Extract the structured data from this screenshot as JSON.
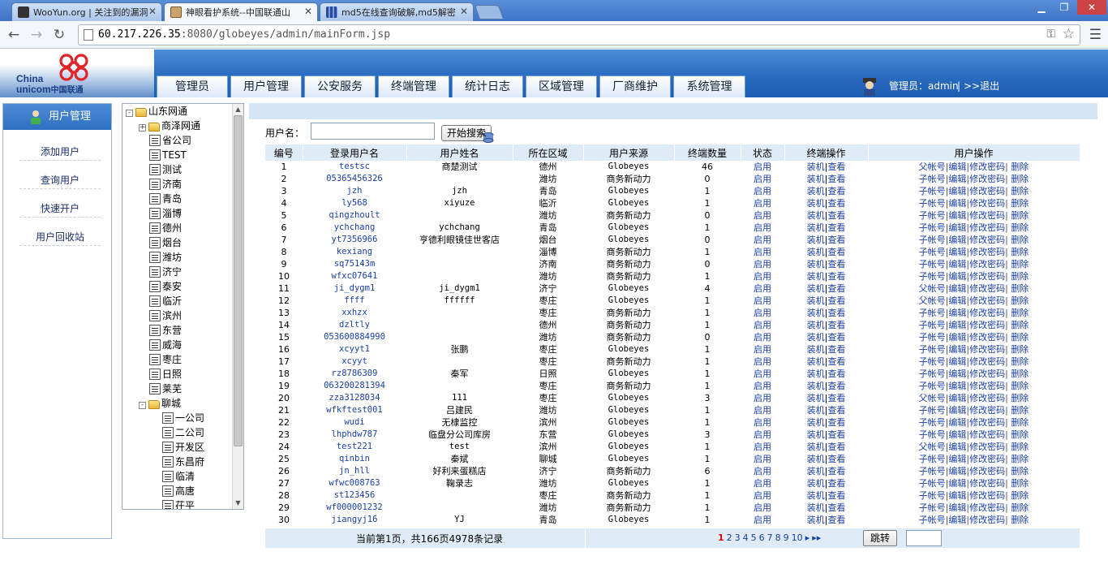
{
  "browser": {
    "tabs": [
      {
        "title": "WooYun.org | 关注到的漏洞"
      },
      {
        "title": "神眼看护系统--中国联通山"
      },
      {
        "title": "md5在线查询破解,md5解密"
      }
    ],
    "url_host": "60.217.226.35",
    "url_rest": ":8080/globeyes/admin/mainForm.jsp"
  },
  "header": {
    "logo_en_1": "China",
    "logo_en_2": "unicom",
    "logo_cn": "中国联通",
    "nav": [
      "管理员",
      "用户管理",
      "公安服务",
      "终端管理",
      "统计日志",
      "区域管理",
      "厂商维护",
      "系统管理"
    ],
    "admin_label": "管理员：",
    "admin_name": "admin",
    "sep": "|",
    "logout": ">>退出"
  },
  "sidebar": {
    "title": "用户管理",
    "items": [
      "添加用户",
      "查询用户",
      "快速开户",
      "用户回收站"
    ]
  },
  "tree": {
    "root": "山东网通",
    "nodes": [
      {
        "label": "商泽网通",
        "type": "folder",
        "expander": "+"
      },
      {
        "label": "省公司",
        "type": "doc"
      },
      {
        "label": "TEST",
        "type": "doc"
      },
      {
        "label": "测试",
        "type": "doc"
      },
      {
        "label": "济南",
        "type": "doc"
      },
      {
        "label": "青岛",
        "type": "doc"
      },
      {
        "label": "淄博",
        "type": "doc"
      },
      {
        "label": "德州",
        "type": "doc"
      },
      {
        "label": "烟台",
        "type": "doc"
      },
      {
        "label": "潍坊",
        "type": "doc"
      },
      {
        "label": "济宁",
        "type": "doc"
      },
      {
        "label": "泰安",
        "type": "doc"
      },
      {
        "label": "临沂",
        "type": "doc"
      },
      {
        "label": "滨州",
        "type": "doc"
      },
      {
        "label": "东营",
        "type": "doc"
      },
      {
        "label": "威海",
        "type": "doc"
      },
      {
        "label": "枣庄",
        "type": "doc"
      },
      {
        "label": "日照",
        "type": "doc"
      },
      {
        "label": "莱芜",
        "type": "doc"
      },
      {
        "label": "聊城",
        "type": "folder",
        "expander": "-"
      }
    ],
    "children": [
      "一公司",
      "二公司",
      "开发区",
      "东昌府",
      "临清",
      "高唐",
      "茌平"
    ]
  },
  "search": {
    "label": "用户名：",
    "value": "",
    "button": "开始搜索"
  },
  "grid": {
    "headers": [
      "编号",
      "登录用户名",
      "用户姓名",
      "所在区域",
      "用户来源",
      "终端数量",
      "状态",
      "终端操作",
      "用户操作"
    ],
    "status_link": "启用",
    "term_ops": [
      "装机",
      "查看"
    ],
    "user_ops_child": "子帐号",
    "user_ops_parent": "父帐号",
    "user_ops": [
      "编辑",
      "修改密码",
      "删除"
    ],
    "rows": [
      [
        "1",
        "testsc",
        "商楚测试",
        "德州",
        "Globeyes",
        "46",
        "P"
      ],
      [
        "2",
        "05365456326",
        "",
        "潍坊",
        "商务新动力",
        "0",
        "C"
      ],
      [
        "3",
        "jzh",
        "jzh",
        "青岛",
        "Globeyes",
        "1",
        "C"
      ],
      [
        "4",
        "ly568",
        "xiyuze",
        "临沂",
        "Globeyes",
        "1",
        "C"
      ],
      [
        "5",
        "qingzhoult",
        "",
        "潍坊",
        "商务新动力",
        "0",
        "C"
      ],
      [
        "6",
        "ychchang",
        "ychchang",
        "青岛",
        "Globeyes",
        "1",
        "C"
      ],
      [
        "7",
        "yt7356966",
        "亨德利眼镜佳世客店",
        "烟台",
        "Globeyes",
        "0",
        "C"
      ],
      [
        "8",
        "kexiang",
        "",
        "淄博",
        "商务新动力",
        "1",
        "C"
      ],
      [
        "9",
        "sq75143m",
        "",
        "济南",
        "商务新动力",
        "0",
        "C"
      ],
      [
        "10",
        "wfxc07641",
        "",
        "潍坊",
        "商务新动力",
        "1",
        "C"
      ],
      [
        "11",
        "ji_dygm1",
        "ji_dygm1",
        "济宁",
        "Globeyes",
        "4",
        "P"
      ],
      [
        "12",
        "ffff",
        "ffffff",
        "枣庄",
        "Globeyes",
        "1",
        "P"
      ],
      [
        "13",
        "xxhzx",
        "",
        "枣庄",
        "商务新动力",
        "1",
        "C"
      ],
      [
        "14",
        "dzltly",
        "",
        "德州",
        "商务新动力",
        "1",
        "C"
      ],
      [
        "15",
        "053600884990",
        "",
        "潍坊",
        "商务新动力",
        "0",
        "C"
      ],
      [
        "16",
        "xcyyt1",
        "张鹏",
        "枣庄",
        "Globeyes",
        "1",
        "C"
      ],
      [
        "17",
        "xcyyt",
        "",
        "枣庄",
        "商务新动力",
        "1",
        "C"
      ],
      [
        "18",
        "rz8786309",
        "秦军",
        "日照",
        "Globeyes",
        "1",
        "C"
      ],
      [
        "19",
        "063200281394",
        "",
        "枣庄",
        "商务新动力",
        "1",
        "C"
      ],
      [
        "20",
        "zza3128034",
        "111",
        "枣庄",
        "Globeyes",
        "3",
        "P"
      ],
      [
        "21",
        "wfkftest001",
        "吕建民",
        "潍坊",
        "Globeyes",
        "1",
        "C"
      ],
      [
        "22",
        "wudi",
        "无棣监控",
        "滨州",
        "Globeyes",
        "1",
        "C"
      ],
      [
        "23",
        "lhphdw787",
        "临盘分公司库房",
        "东营",
        "Globeyes",
        "3",
        "C"
      ],
      [
        "24",
        "test221",
        "test",
        "滨州",
        "Globeyes",
        "1",
        "P"
      ],
      [
        "25",
        "qinbin",
        "秦斌",
        "聊城",
        "Globeyes",
        "1",
        "C"
      ],
      [
        "26",
        "jn_hll",
        "好利来蛋糕店",
        "济宁",
        "商务新动力",
        "6",
        "C"
      ],
      [
        "27",
        "wfwc008763",
        "鞠录志",
        "潍坊",
        "Globeyes",
        "1",
        "C"
      ],
      [
        "28",
        "st123456",
        "",
        "枣庄",
        "商务新动力",
        "1",
        "C"
      ],
      [
        "29",
        "wf000001232",
        "",
        "潍坊",
        "商务新动力",
        "1",
        "C"
      ],
      [
        "30",
        "jiangyj16",
        "YJ",
        "青岛",
        "Globeyes",
        "1",
        "C"
      ]
    ]
  },
  "footer": {
    "pageinfo": "当前第1页，共166页4978条记录",
    "pages": [
      "1",
      "2",
      "3",
      "4",
      "5",
      "6",
      "7",
      "8",
      "9",
      "10"
    ],
    "next": "▸",
    "last": "▸▸",
    "jump": "跳转"
  },
  "colors": {
    "header_blue": "#2a6cc0",
    "link_blue": "#1a3fa6",
    "grid_header": "#dfecf8"
  }
}
